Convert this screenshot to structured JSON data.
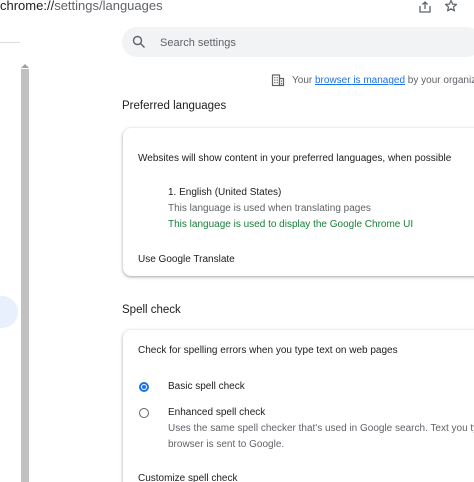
{
  "address_bar": {
    "url_scheme": "chrome://",
    "url_path": "settings/languages"
  },
  "search": {
    "placeholder": "Search settings"
  },
  "managed_notice": {
    "prefix": "Your ",
    "link": "browser is managed",
    "suffix": " by your organiz"
  },
  "preferred_languages": {
    "title": "Preferred languages",
    "description": "Websites will show content in your preferred languages, when possible",
    "languages": [
      {
        "name": "1. English (United States)",
        "note_translate": "This language is used when translating pages",
        "note_display": "This language is used to display the Google Chrome UI"
      }
    ],
    "translate_label": "Use Google Translate"
  },
  "spell_check": {
    "title": "Spell check",
    "description": "Check for spelling errors when you type text on web pages",
    "options": [
      {
        "label": "Basic spell check",
        "selected": true
      },
      {
        "label": "Enhanced spell check",
        "selected": false,
        "description_line1": "Uses the same spell checker that's used in Google search. Text you ty",
        "description_line2": "browser is sent to Google."
      }
    ],
    "customize_label": "Customize spell check"
  },
  "colors": {
    "accent": "#1a73e8",
    "green_note": "#188038",
    "secondary_text": "#5f6368"
  }
}
